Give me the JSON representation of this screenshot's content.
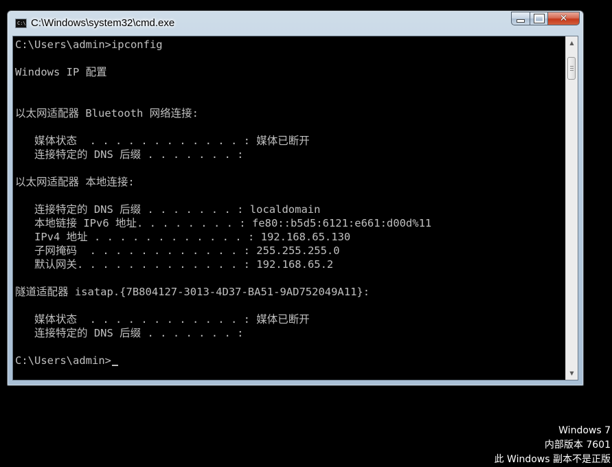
{
  "window": {
    "title": "C:\\Windows\\system32\\cmd.exe",
    "icon_label": "C:\\",
    "controls": {
      "minimize_icon": "minimize-icon",
      "maximize_icon": "maximize-icon",
      "close_icon": "close-icon"
    }
  },
  "console": {
    "lines": [
      "C:\\Users\\admin>ipconfig",
      "",
      "Windows IP 配置",
      "",
      "",
      "以太网适配器 Bluetooth 网络连接:",
      "",
      "   媒体状态  . . . . . . . . . . . . : 媒体已断开",
      "   连接特定的 DNS 后缀 . . . . . . . :",
      "",
      "以太网适配器 本地连接:",
      "",
      "   连接特定的 DNS 后缀 . . . . . . . : localdomain",
      "   本地链接 IPv6 地址. . . . . . . . : fe80::b5d5:6121:e661:d00d%11",
      "   IPv4 地址 . . . . . . . . . . . . : 192.168.65.130",
      "   子网掩码  . . . . . . . . . . . . : 255.255.255.0",
      "   默认网关. . . . . . . . . . . . . : 192.168.65.2",
      "",
      "隧道适配器 isatap.{7B804127-3013-4D37-BA51-9AD752049A11}:",
      "",
      "   媒体状态  . . . . . . . . . . . . : 媒体已断开",
      "   连接特定的 DNS 后缀 . . . . . . . :",
      "",
      "C:\\Users\\admin>"
    ]
  },
  "scrollbar": {
    "up_icon": "scroll-up-arrow-icon",
    "down_icon": "scroll-down-arrow-icon"
  },
  "watermark": {
    "os_name": "Windows 7",
    "build": "内部版本 7601",
    "notice": "此 Windows 副本不是正版"
  },
  "colors": {
    "console_background": "#000000",
    "console_text": "#c0c0c0",
    "desktop_background": "#000000",
    "close_button": "#c6391a"
  }
}
